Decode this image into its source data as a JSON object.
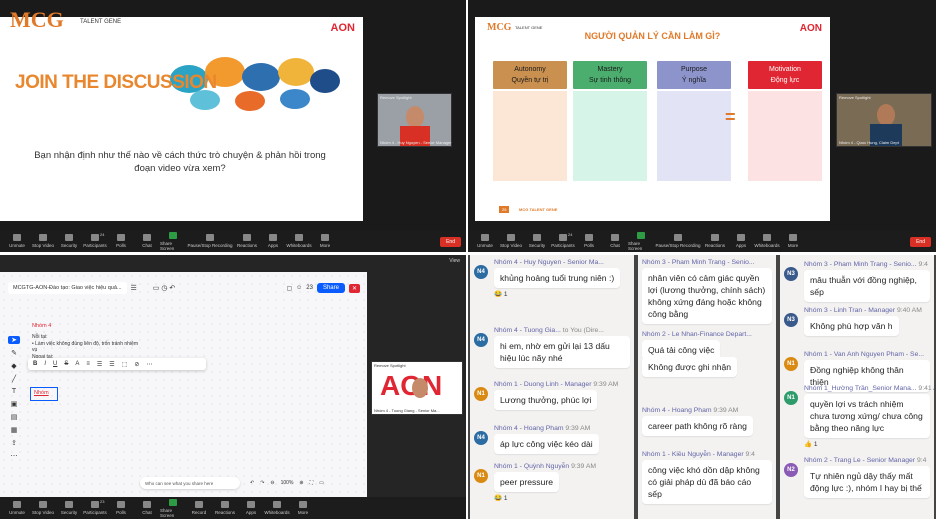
{
  "q1": {
    "logo": "MCG",
    "logo_sub": "TALENT GENE",
    "brand": "AON",
    "heading": "JOIN THE DISCUSSION",
    "question": "Bạn nhận định như thế nào về cách thức trò chuyện & phản hồi trong đoạn video vừa xem?",
    "video_name": "Nhóm 4 - Huy Nguyen - Senior Manager",
    "video_tag": "Remove Spotlight"
  },
  "q2": {
    "logo": "MCG",
    "logo_sub": "TALENT GENE",
    "brand": "AON",
    "title": "NGƯỜI QUẢN LÝ CẦN LÀM GÌ?",
    "cols": [
      {
        "en": "Autonomy",
        "vi": "Quyền tự trị",
        "color": "#c9904f",
        "body": "#fce6d6"
      },
      {
        "en": "Mastery",
        "vi": "Sự tinh thông",
        "color": "#4cae6e",
        "body": "#d6f5e8"
      },
      {
        "en": "Purpose",
        "vi": "Ý nghĩa",
        "color": "#8d94cc",
        "body": "#e2e4f5"
      }
    ],
    "eq": "=",
    "motivation": {
      "en": "Motivation",
      "vi": "Động lực",
      "color": "#e02632",
      "body": "#fde2e4"
    },
    "footer_num": "25",
    "footer": "MCG TALENT GENE",
    "video_name": "Nhóm 4 - Quoc Hung, Claim Dept",
    "video_tag": "Remove Spotlight"
  },
  "q3": {
    "view_label": "View",
    "board_title": "MCGTG-AON-Đào tạo: Giao việc hiệu quả...",
    "share": "Share",
    "zoom_num": "23",
    "note_title": "Nhóm 4",
    "note_lines": [
      "Nỗi tại:",
      "• Làm việc không đúng liên độ, trốn tránh nhiệm vụ",
      "Ngoại tại:",
      "• Gia đình, con cái => cần về sớm hơn"
    ],
    "sticky": "Nhóm",
    "who_can_see": "Who can see what you share here",
    "zoom_level": "100%",
    "video_name": "Nhóm 4 - Tuong Giang - Senior Ma...",
    "video_tag": "Remove Spotlight",
    "brand": "AON"
  },
  "toolbar": [
    "Unmute",
    "Stop Video",
    "Security",
    "Participants",
    "Polls",
    "Chat",
    "Share Screen",
    "Pause/Stop Recording",
    "Reactions",
    "Apps",
    "Whiteboards",
    "More"
  ],
  "toolbar3": [
    "Unmute",
    "Stop Video",
    "Security",
    "Participants",
    "Polls",
    "Chat",
    "Share Screen",
    "Record",
    "Reactions",
    "Apps",
    "Whiteboards",
    "More"
  ],
  "participants_count": "24",
  "participants_count3": "23",
  "end": "End",
  "chat1": [
    {
      "av": "N4",
      "avc": "#2b6ca3",
      "name": "Nhóm 4 - Huy Nguyen - Senior Ma...",
      "time": "",
      "text": "khủng hoảng tuổi trung niên :)",
      "react": "😂 1"
    },
    {
      "av": "N4",
      "avc": "#2b6ca3",
      "name": "Nhóm 4 - Tuong Gia...",
      "time": "to You (Dire...",
      "text": "hi em, nhờ em gửi lại 13 dấu hiệu lúc nãy nhé",
      "react": ""
    },
    {
      "av": "N1",
      "avc": "#d98a13",
      "name": "Nhóm 1 - Duong Linh - Manager",
      "time": "9:39 AM",
      "text": "Lương thưởng, phúc lợi",
      "react": ""
    },
    {
      "av": "N4",
      "avc": "#2b6ca3",
      "name": "Nhóm 4 - Hoang Pham",
      "time": "9:39 AM",
      "text": "áp lực công việc kéo dài",
      "react": ""
    },
    {
      "av": "N1",
      "avc": "#d98a13",
      "name": "Nhóm 1 - Quỳnh Nguyễn",
      "time": "9:39 AM",
      "text": "peer pressure",
      "react": "😂 1"
    }
  ],
  "chat2": [
    {
      "name": "Nhóm 3 - Pham Minh Trang - Senio...",
      "time": "",
      "text": "nhân viên có cảm giác quyền lợi (lương thưởng, chính sách) không xứng đáng hoặc không công bằng"
    },
    {
      "name": "Nhóm 2 - Le Nhan-Finance Depart...",
      "time": "",
      "text": "Quá tải công việc"
    },
    {
      "name": "",
      "time": "",
      "text": "Không được ghi nhận"
    },
    {
      "name": "Nhóm 4 - Hoang Pham",
      "time": "9:39 AM",
      "text": "career path không rõ ràng"
    },
    {
      "name": "Nhóm 1 - Kiều Nguyễn - Manager",
      "time": "9:4",
      "text": "công việc khó dồn dập không có giải pháp dù đã báo cáo sếp"
    }
  ],
  "chat3": [
    {
      "av": "N3",
      "avc": "#3a5a8c",
      "name": "Nhóm 3 - Pham Minh Trang - Senio...",
      "time": "9:4",
      "text": "mâu thuẫn với đồng nghiệp, sếp",
      "react": ""
    },
    {
      "av": "N3",
      "avc": "#3a5a8c",
      "name": "Nhóm 3 - Linh Tran - Manager",
      "time": "9:40 AM",
      "text": "Không phù hợp văn h",
      "react": ""
    },
    {
      "av": "N1",
      "avc": "#d98a13",
      "name": "Nhóm 1 - Van Anh Nguyen Pham - Se...",
      "time": "",
      "text": "Đồng nghiệp không thân thiện",
      "react": ""
    },
    {
      "av": "N1",
      "avc": "#2e9b6a",
      "name": "Nhóm 1_Hường Trần_Senior Mana...",
      "time": "9:41 A",
      "text": "quyền lợi vs trách nhiệm chưa tương xứng/ chưa công bằng theo năng lực",
      "react": "👍 1"
    },
    {
      "av": "N2",
      "avc": "#8a5ab5",
      "name": "Nhóm 2 - Trang Le - Senior Manager",
      "time": "9:4",
      "text": "Tự nhiên ngủ dậy thấy mất động lực :), nhóm I hay bị thế",
      "react": ""
    }
  ]
}
